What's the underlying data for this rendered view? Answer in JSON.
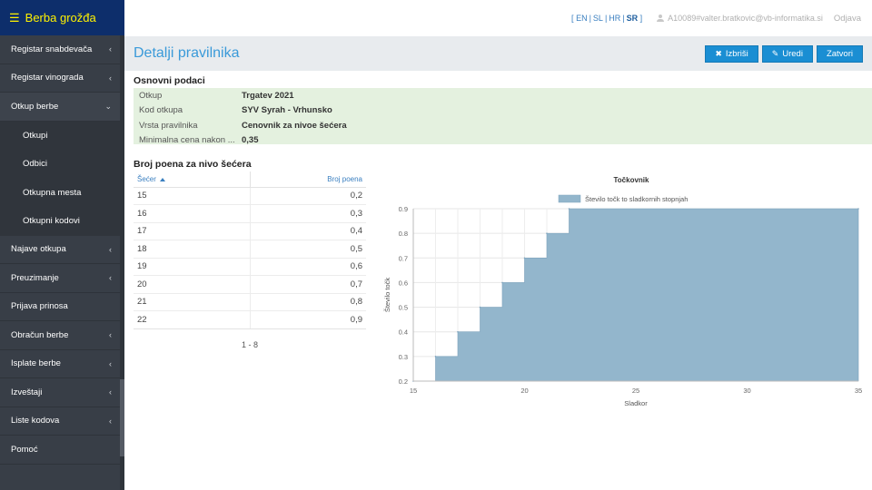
{
  "app": {
    "title": "Berba grožđa"
  },
  "sidebar": {
    "items": [
      {
        "label": "Registar snabdevača",
        "chevron": "‹"
      },
      {
        "label": "Registar vinograda",
        "chevron": "‹"
      },
      {
        "label": "Otkup berbe",
        "chevron": "⌄"
      },
      {
        "label": "Najave otkupa",
        "chevron": "‹"
      },
      {
        "label": "Preuzimanje",
        "chevron": "‹"
      },
      {
        "label": "Prijava prinosa",
        "chevron": ""
      },
      {
        "label": "Obračun berbe",
        "chevron": "‹"
      },
      {
        "label": "Isplate berbe",
        "chevron": "‹"
      },
      {
        "label": "Izveštaji",
        "chevron": "‹"
      },
      {
        "label": "Liste kodova",
        "chevron": "‹"
      },
      {
        "label": "Pomoć",
        "chevron": ""
      }
    ],
    "subitems": [
      "Otkupi",
      "Odbici",
      "Otkupna mesta",
      "Otkupni kodovi"
    ]
  },
  "topbar": {
    "lang_open": "[",
    "lang_close": "]",
    "langs": [
      "EN",
      "SL",
      "HR",
      "SR"
    ],
    "active_lang": "SR",
    "user": "A10089#valter.bratkovic@vb-informatika.si",
    "logout": "Odjava"
  },
  "header": {
    "title": "Detalji pravilnika",
    "delete_label": "Izbriši",
    "edit_label": "Uredi",
    "close_label": "Zatvori"
  },
  "basic": {
    "title": "Osnovni podaci",
    "rows": [
      {
        "label": "Otkup",
        "value": "Trgatev 2021"
      },
      {
        "label": "Kod otkupa",
        "value": "SYV Syrah - Vrhunsko"
      },
      {
        "label": "Vrsta pravilnika",
        "value": "Cenovnik za nivoe šećera"
      },
      {
        "label": "Minimalna cena nakon ...",
        "value": "0,35"
      }
    ]
  },
  "points": {
    "title": "Broj poena za nivo šećera",
    "col_sugar": "Šećer",
    "col_points": "Broj poena",
    "rows": [
      {
        "sugar": "15",
        "points": "0,2"
      },
      {
        "sugar": "16",
        "points": "0,3"
      },
      {
        "sugar": "17",
        "points": "0,4"
      },
      {
        "sugar": "18",
        "points": "0,5"
      },
      {
        "sugar": "19",
        "points": "0,6"
      },
      {
        "sugar": "20",
        "points": "0,7"
      },
      {
        "sugar": "21",
        "points": "0,8"
      },
      {
        "sugar": "22",
        "points": "0,9"
      }
    ],
    "pager": "1 - 8"
  },
  "chart_data": {
    "type": "area",
    "title": "Točkovnik",
    "legend": "Število točk to sladkornih stopnjah",
    "xlabel": "Sladkor",
    "ylabel": "Število točk",
    "x": [
      15,
      16,
      17,
      18,
      19,
      20,
      21,
      22,
      35
    ],
    "y": [
      0.2,
      0.3,
      0.4,
      0.5,
      0.6,
      0.7,
      0.8,
      0.9,
      0.9
    ],
    "step": true,
    "xlim": [
      15,
      35
    ],
    "ylim": [
      0.2,
      0.9
    ],
    "xticks": [
      "15",
      "20",
      "25",
      "30",
      "35"
    ],
    "yticks": [
      "0.2",
      "0.3",
      "0.4",
      "0.5",
      "0.6",
      "0.7",
      "0.8",
      "0.9"
    ],
    "legend_position": "top-center",
    "color": "#93b6cc"
  }
}
